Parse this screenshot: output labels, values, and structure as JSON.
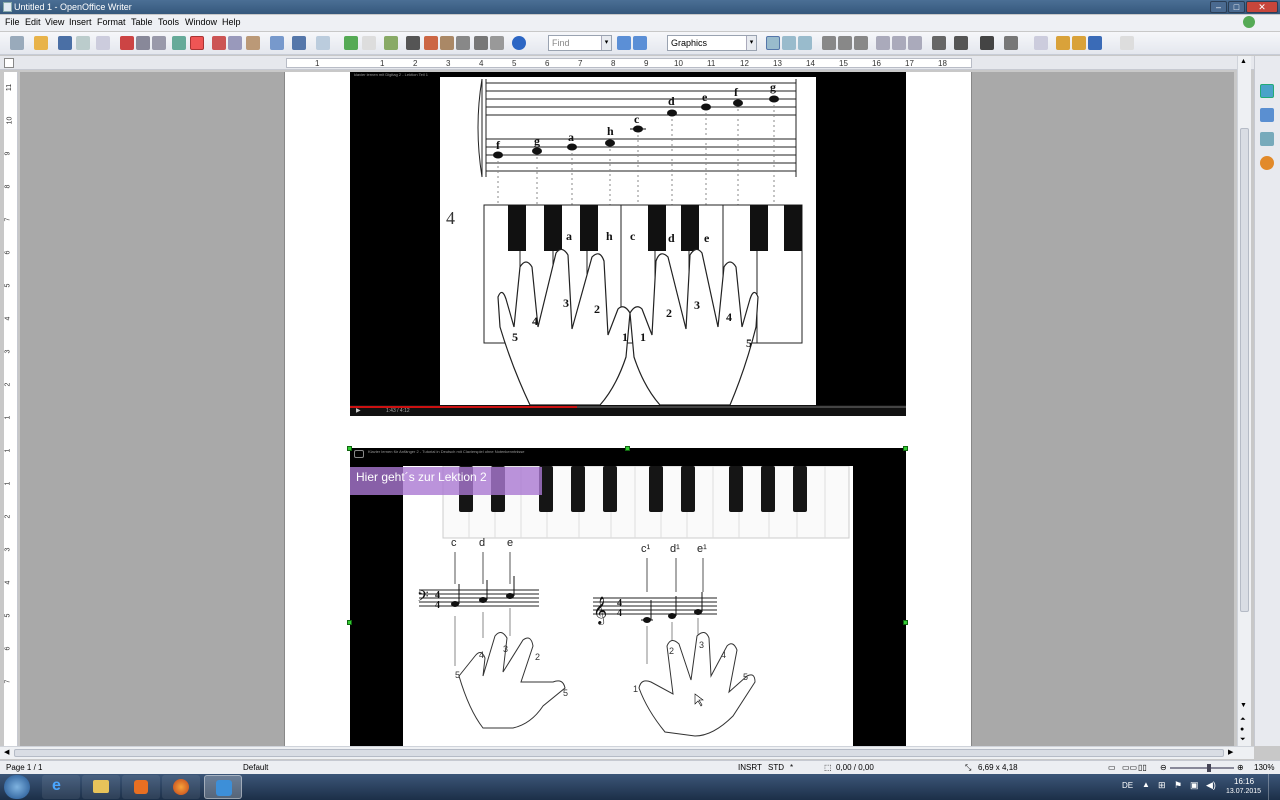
{
  "window": {
    "title": "Untitled 1 - OpenOffice Writer",
    "btn_min": "–",
    "btn_max": "□",
    "btn_close": "✕"
  },
  "menu": [
    "File",
    "Edit",
    "View",
    "Insert",
    "Format",
    "Table",
    "Tools",
    "Window",
    "Help"
  ],
  "toolbar": {
    "find_placeholder": "Find",
    "style_value": "Graphics"
  },
  "ruler": {
    "h_numbers": [
      "1",
      "1",
      "2",
      "3",
      "4",
      "5",
      "6",
      "7",
      "8",
      "9",
      "10",
      "11",
      "12",
      "13",
      "14",
      "15",
      "16",
      "17",
      "18"
    ],
    "v_numbers": [
      "11",
      "10",
      "9",
      "8",
      "7",
      "6",
      "5",
      "4",
      "3",
      "2",
      "1",
      "1",
      "1",
      "2",
      "3",
      "4",
      "5",
      "6",
      "7"
    ]
  },
  "image1": {
    "caption": "klavier lernen mit Digitag 2 - Lektion Teil 1",
    "notes": [
      "f",
      "g",
      "a",
      "h",
      "c",
      "d",
      "e",
      "f",
      "g"
    ],
    "figure_number": "4",
    "key_labels": [
      "a",
      "h",
      "c",
      "d",
      "e"
    ],
    "left_fingers": [
      "5",
      "4",
      "3",
      "2",
      "1"
    ],
    "right_fingers": [
      "1",
      "2",
      "3",
      "4",
      "5"
    ],
    "time": "1:43 / 4:12"
  },
  "image2": {
    "caption": "Klavier lernen für Anfänger 2 - Tutorial in Deutsch mit Clavierspiel ohne Notenkenntnisse",
    "link_text": "Hier geht´s zur Lektion 2",
    "left_labels": [
      "c",
      "d",
      "e"
    ],
    "right_labels": [
      "c¹",
      "d¹",
      "e¹"
    ],
    "time_sig": [
      "4",
      "4"
    ],
    "left_fingers": [
      "5",
      "4",
      "3",
      "2",
      "5"
    ],
    "right_fingers": [
      "1",
      "2",
      "3",
      "4",
      "5"
    ]
  },
  "status": {
    "page": "Page 1 / 1",
    "style": "Default",
    "mode": "INSRT",
    "sel": "STD",
    "star": "*",
    "pos": "0,00 / 0,00",
    "size": "6,69 x 4,18",
    "zoom": "130%"
  },
  "taskbar": {
    "lang": "DE",
    "time": "16:16",
    "date": "13.07.2015"
  },
  "colors": {
    "accent": "#2b4a6f",
    "link_bg": "#aa78d2",
    "handle": "#33cc33",
    "progress": "#cc1111"
  }
}
